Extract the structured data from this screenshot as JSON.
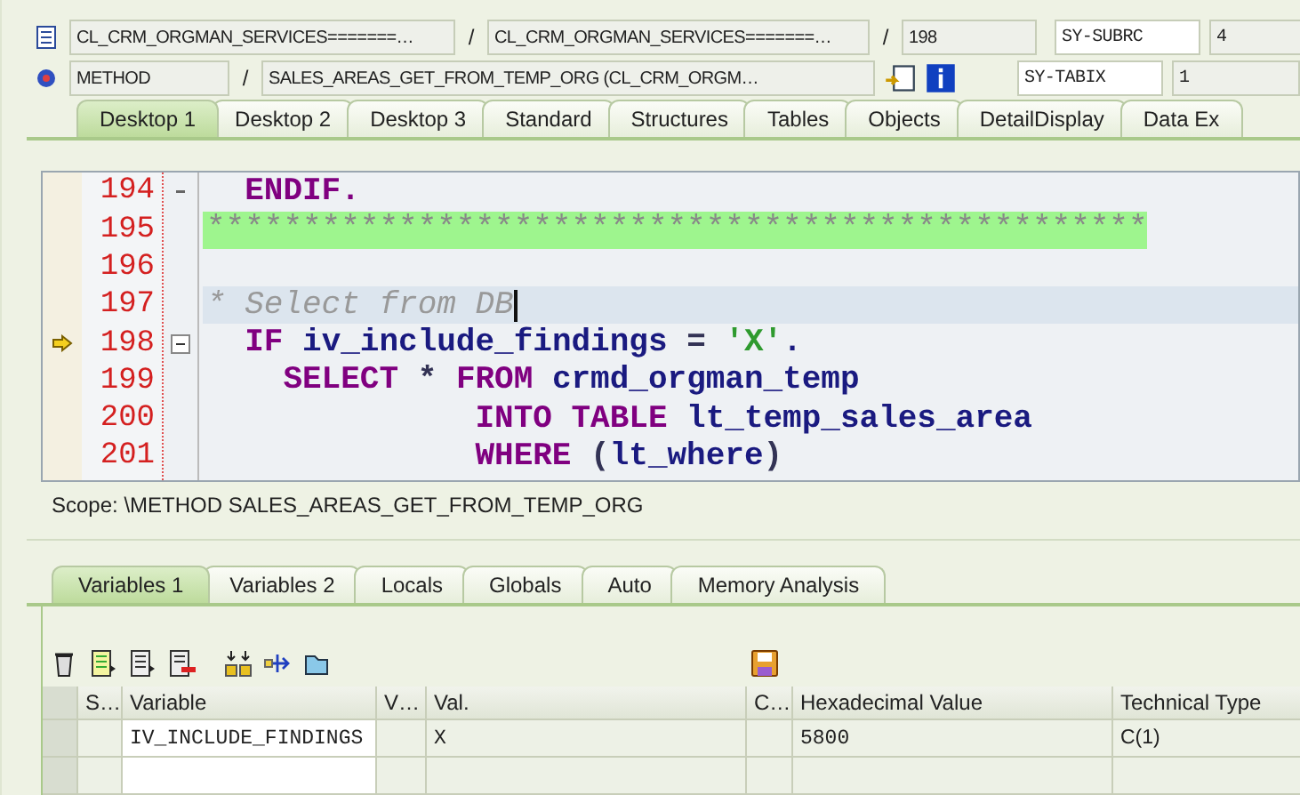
{
  "header_rows": [
    {
      "items": [
        {
          "kind": "field",
          "value": "CL_CRM_ORGMAN_SERVICES=======…"
        },
        {
          "kind": "separator",
          "value": "/"
        },
        {
          "kind": "field",
          "value": "CL_CRM_ORGMAN_SERVICES=======…"
        },
        {
          "kind": "separator",
          "value": "/"
        },
        {
          "kind": "field",
          "value": "198"
        }
      ],
      "system_field": {
        "name": "SY-SUBRC",
        "value": "4"
      }
    },
    {
      "items": [
        {
          "kind": "field",
          "value": "METHOD"
        },
        {
          "kind": "separator",
          "value": "/"
        },
        {
          "kind": "field",
          "value": "SALES_AREAS_GET_FROM_TEMP_ORG (CL_CRM_ORGM…"
        }
      ],
      "system_field": {
        "name": "SY-TABIX",
        "value": "1"
      }
    }
  ],
  "desktop_tabs": [
    {
      "label": "Desktop 1",
      "selected": true
    },
    {
      "label": "Desktop 2",
      "selected": false
    },
    {
      "label": "Desktop 3",
      "selected": false
    },
    {
      "label": "Standard",
      "selected": false
    },
    {
      "label": "Structures",
      "selected": false
    },
    {
      "label": "Tables",
      "selected": false
    },
    {
      "label": "Objects",
      "selected": false
    },
    {
      "label": "DetailDisplay",
      "selected": false
    },
    {
      "label": "Data Ex",
      "selected": false
    }
  ],
  "code_lines": [
    {
      "number": "194",
      "fold_start": false,
      "fold_end": true,
      "current": false,
      "selected": false,
      "highlighted": false,
      "tokens": [
        {
          "kind": "keyword",
          "text": "  ENDIF."
        }
      ]
    },
    {
      "number": "195",
      "fold_start": false,
      "fold_end": false,
      "current": false,
      "selected": false,
      "highlighted": true,
      "tokens": [
        {
          "kind": "stars",
          "text": "*************************************************"
        }
      ]
    },
    {
      "number": "196",
      "fold_start": false,
      "fold_end": false,
      "current": false,
      "selected": false,
      "highlighted": false
    },
    {
      "number": "197",
      "fold_start": false,
      "fold_end": false,
      "current": false,
      "selected": true,
      "highlighted": false,
      "tokens": [
        {
          "kind": "comment",
          "text": "* Select from DB"
        }
      ]
    },
    {
      "number": "198",
      "fold_start": true,
      "fold_end": false,
      "current": true,
      "selected": false,
      "highlighted": false,
      "tokens": [
        {
          "kind": "keyword",
          "text": "  IF"
        },
        {
          "kind": "identifier",
          "text": " iv_include_findings"
        },
        {
          "kind": "plain",
          "text": " = "
        },
        {
          "kind": "string",
          "text": "'X'"
        },
        {
          "kind": "identifier",
          "text": "."
        }
      ]
    },
    {
      "number": "199",
      "fold_start": false,
      "fold_end": false,
      "current": false,
      "selected": false,
      "highlighted": false,
      "tokens": [
        {
          "kind": "keyword",
          "text": "    SELECT"
        },
        {
          "kind": "plain",
          "text": " * "
        },
        {
          "kind": "keyword",
          "text": "FROM"
        },
        {
          "kind": "identifier",
          "text": " crmd_orgman_temp"
        }
      ]
    },
    {
      "number": "200",
      "fold_start": false,
      "fold_end": false,
      "current": false,
      "selected": false,
      "highlighted": false,
      "tokens": [
        {
          "kind": "keyword",
          "text": "              INTO TABLE"
        },
        {
          "kind": "identifier",
          "text": " lt_temp_sales_area"
        }
      ]
    },
    {
      "number": "201",
      "fold_start": false,
      "fold_end": false,
      "current": false,
      "selected": false,
      "highlighted": false,
      "tokens": [
        {
          "kind": "keyword",
          "text": "              WHERE"
        },
        {
          "kind": "plain",
          "text": " ("
        },
        {
          "kind": "identifier",
          "text": "lt_where"
        },
        {
          "kind": "plain",
          "text": ")"
        }
      ]
    }
  ],
  "scope": "Scope: \\METHOD SALES_AREAS_GET_FROM_TEMP_ORG",
  "variable_tabs": [
    {
      "label": "Variables 1",
      "selected": true
    },
    {
      "label": "Variables 2",
      "selected": false
    },
    {
      "label": "Locals",
      "selected": false
    },
    {
      "label": "Globals",
      "selected": false
    },
    {
      "label": "Auto",
      "selected": false
    },
    {
      "label": "Memory Analysis",
      "selected": false
    }
  ],
  "table": {
    "columns": [
      "S…",
      "Variable",
      "V…",
      "Val.",
      "C…",
      "Hexadecimal Value",
      "Technical Type"
    ],
    "rows": [
      {
        "variable": "IV_INCLUDE_FINDINGS",
        "value": "X",
        "hex": "5800",
        "type": "C(1)"
      }
    ]
  }
}
